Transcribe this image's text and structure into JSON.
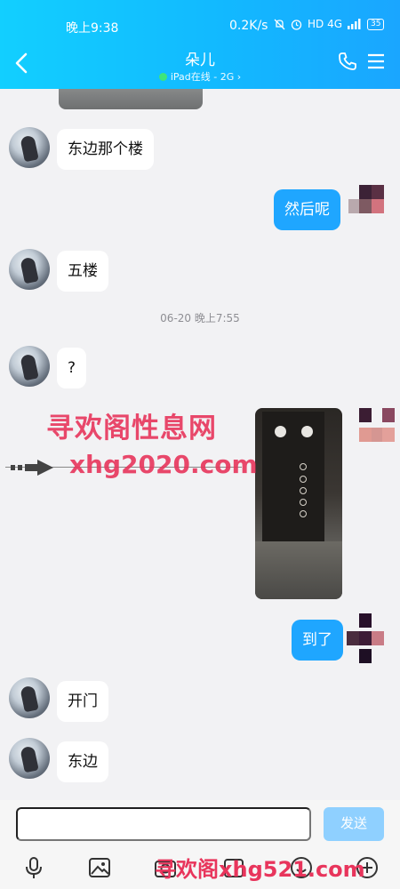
{
  "status_bar": {
    "time": "晚上9:38",
    "network_speed": "0.2K/s",
    "extra": "HD 4G",
    "battery": "35"
  },
  "header": {
    "title": "朵儿",
    "presence": "iPad在线 - 2G",
    "presence_chevron": "›"
  },
  "messages": [
    {
      "side": "left",
      "text": "东边那个楼"
    },
    {
      "side": "right",
      "text": "然后呢"
    },
    {
      "side": "left",
      "text": "五楼"
    },
    {
      "side": "system",
      "text": "06-20 晚上7:55"
    },
    {
      "side": "left",
      "text": "?"
    },
    {
      "side": "right",
      "type": "image"
    },
    {
      "side": "right",
      "text": "到了"
    },
    {
      "side": "left",
      "text": "开门"
    },
    {
      "side": "left",
      "text": "东边"
    }
  ],
  "watermarks": {
    "line1": "寻欢阁性息网",
    "line2": "xhg2020.com",
    "bottom": "寻欢阁xhg521.com"
  },
  "input": {
    "placeholder": "",
    "send_label": "发送"
  },
  "colors": {
    "header_gradient_start": "#12cfff",
    "header_gradient_end": "#1aa6ff",
    "bubble_mine": "#1fa6ff",
    "bubble_theirs": "#ffffff",
    "send_disabled": "#8fd0ff",
    "watermark": "#e8355c"
  },
  "icons": [
    "back-arrow-icon",
    "phone-icon",
    "menu-icon",
    "microphone-icon",
    "image-icon",
    "camera-icon",
    "emoji-icon",
    "plus-icon"
  ]
}
